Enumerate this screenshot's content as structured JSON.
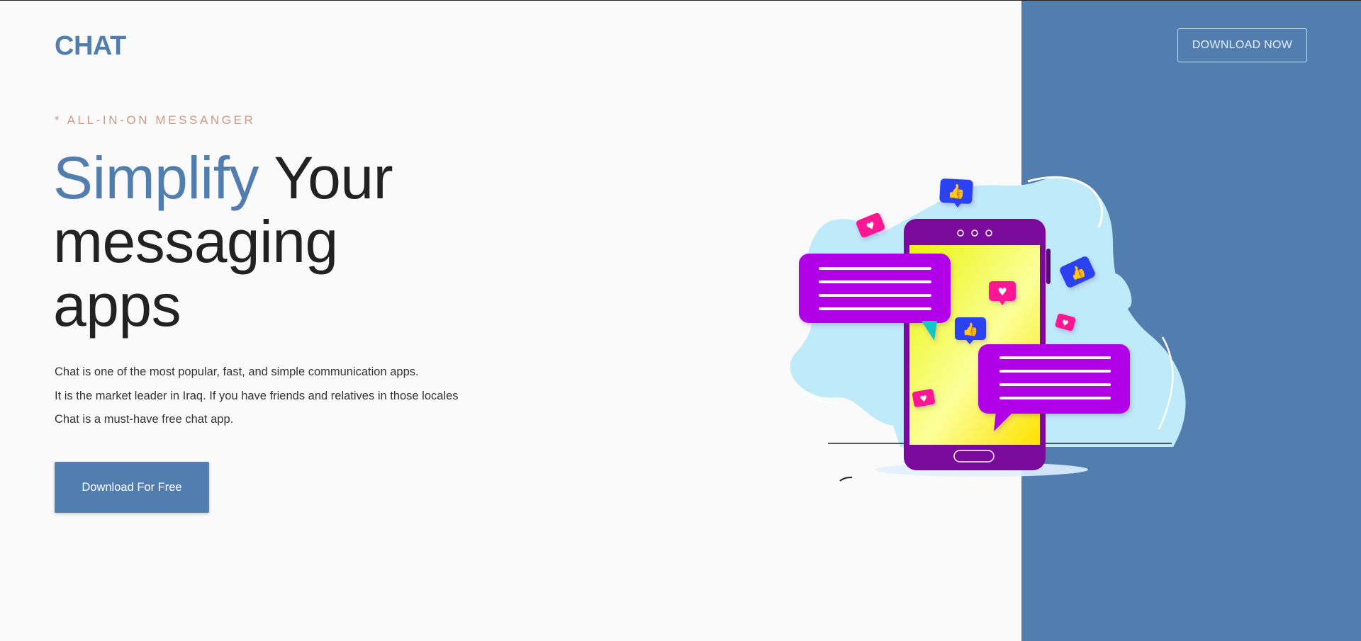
{
  "brand": {
    "logo": "CHAT"
  },
  "header": {
    "download_now_label": "DOWNLOAD NOW"
  },
  "hero": {
    "tagline": "* ALL-IN-ON MESSANGER",
    "headline_accent": "Simplify",
    "headline_rest": " Your messaging apps",
    "description_lines": [
      "Chat is one of the most popular, fast, and simple communication apps.",
      "It is the market leader in Iraq. If you have friends and relatives in those locales",
      "Chat is a must-have free chat app."
    ],
    "cta_label": "Download For Free"
  },
  "colors": {
    "brand": "#527daf",
    "tagline": "#c99a86",
    "heading": "#222222",
    "phone": "#7a0a9c",
    "bubble": "#b100e8",
    "like_badge": "#2b43f0",
    "heart_badge": "#ff1493",
    "blob": "#bfeaf9"
  },
  "icons": [
    "phone-illustration",
    "chat-bubble-icon",
    "thumbs-up-icon",
    "heart-icon"
  ]
}
